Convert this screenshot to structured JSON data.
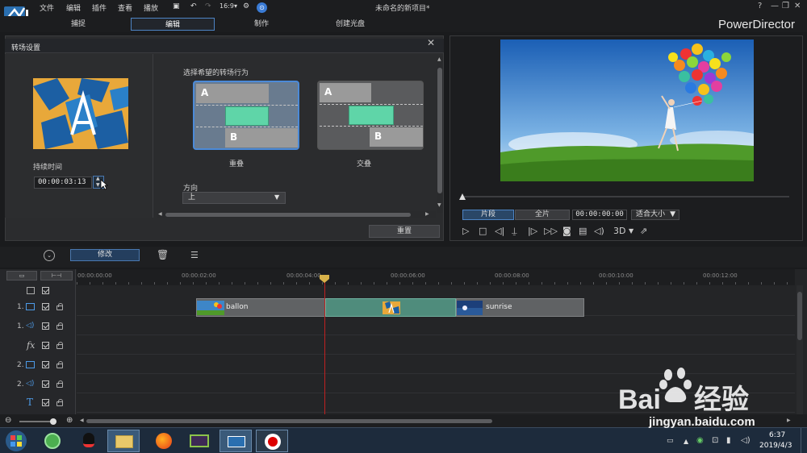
{
  "app": {
    "menus": [
      "文件",
      "编辑",
      "插件",
      "查看",
      "播放"
    ],
    "doc_title": "未命名的新项目*",
    "brand": "PowerDirector",
    "window_controls": [
      "?",
      "—",
      "❐",
      "✕"
    ]
  },
  "modes": {
    "capture": "捕捉",
    "edit": "编辑",
    "produce": "制作",
    "create_disc": "创建光盘"
  },
  "transition_panel": {
    "title": "转场设置",
    "duration_label": "持续时间",
    "duration_value": "00:00:03:13",
    "choose_label": "选择希望的转场行为",
    "options": [
      {
        "label": "重叠",
        "a": "A",
        "b": "B",
        "selected": true
      },
      {
        "label": "交叠",
        "a": "A",
        "b": "B",
        "selected": false
      }
    ],
    "direction_label": "方向",
    "direction_value": "上",
    "reset_label": "重置"
  },
  "preview": {
    "clip_label": "片段",
    "full_label": "全片",
    "timecode": "00:00:00:00",
    "fit_label": "适合大小",
    "three_d": "3D"
  },
  "toolbar": {
    "modify_label": "修改"
  },
  "timeline": {
    "ruler": [
      "00:00:00:00",
      "00:00:02:00",
      "00:00:04:00",
      "00:00:06:00",
      "00:00:08:00",
      "00:00:10:00",
      "00:00:12:00"
    ],
    "tracks": [
      {
        "label": "1.",
        "type": "video"
      },
      {
        "label": "1.",
        "type": "audio"
      },
      {
        "label": "fx",
        "type": "effect"
      },
      {
        "label": "2.",
        "type": "video"
      },
      {
        "label": "2.",
        "type": "audio"
      },
      {
        "label": "T",
        "type": "title"
      }
    ],
    "clips": [
      {
        "name": "ballon"
      },
      {
        "name": "sunrise"
      }
    ]
  },
  "taskbar": {
    "time": "6:37",
    "date": "2019/4/3"
  },
  "watermark": {
    "text": "jingyan.baidu.com",
    "brand": "Bai经验"
  },
  "colors": {
    "accent": "#4b8ad8",
    "transition_block": "#5fd5a8",
    "playhead": "#c02020"
  }
}
